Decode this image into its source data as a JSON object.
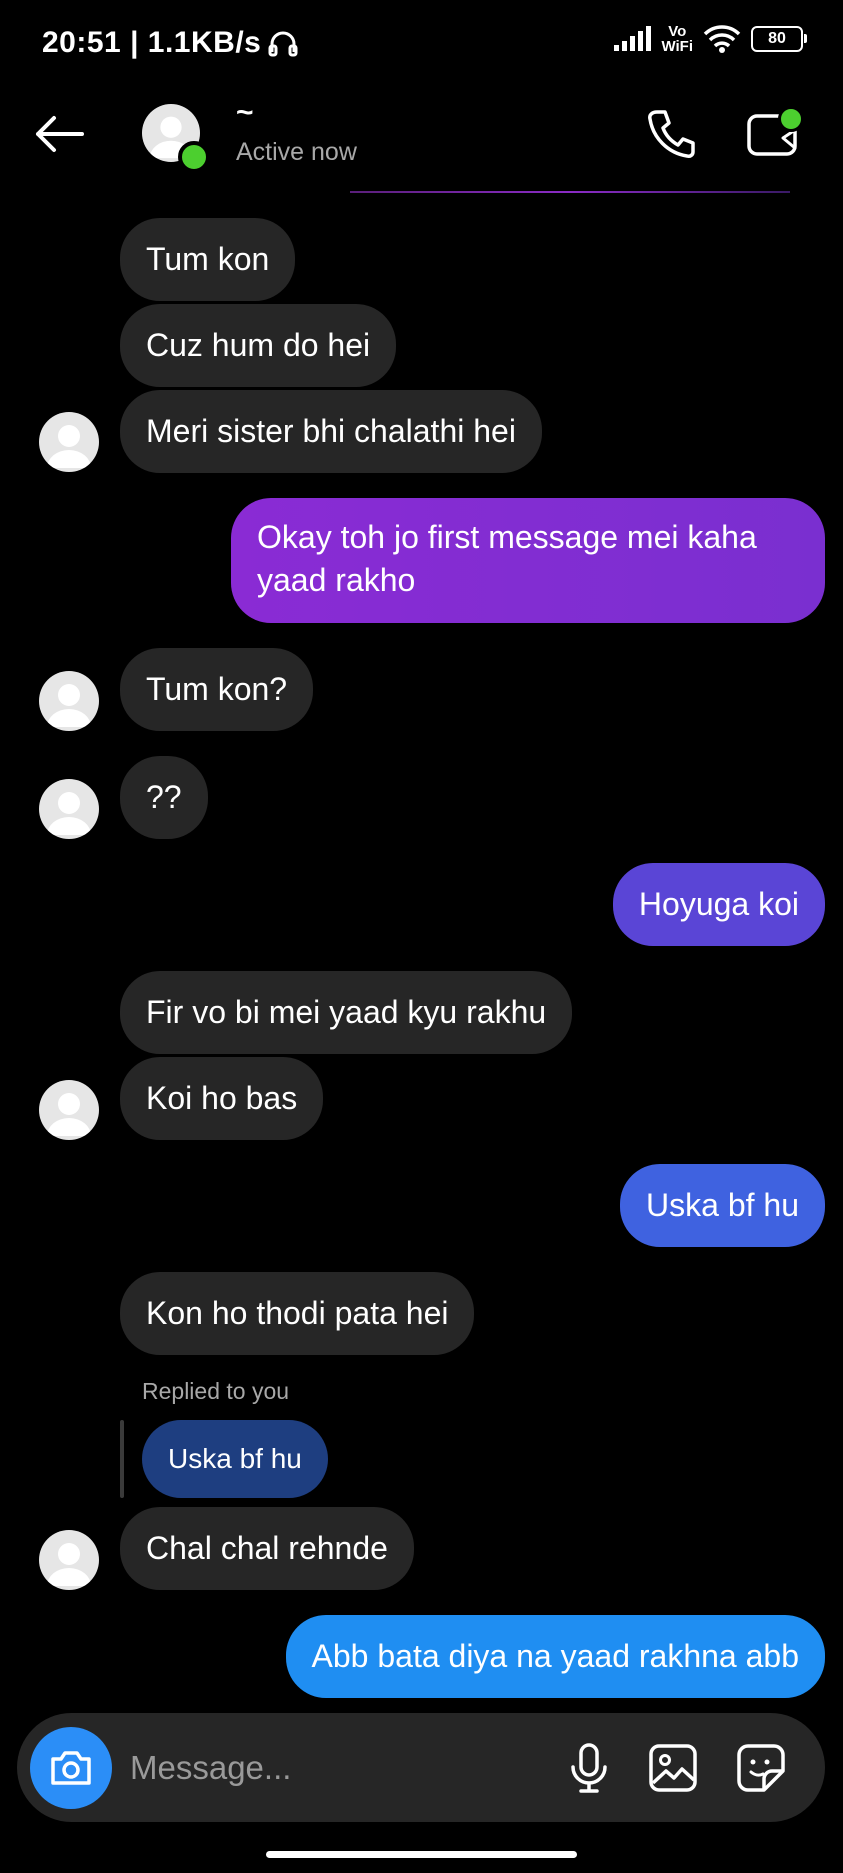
{
  "status_bar": {
    "time_speed": "20:51 | 1.1KB/s",
    "vowifi_top": "Vo",
    "vowifi_bottom": "WiFi",
    "battery": "80"
  },
  "header": {
    "contact_name": "~",
    "contact_status": "Active now",
    "icons": [
      "back-arrow-icon",
      "phone-icon",
      "video-camera-icon"
    ]
  },
  "messages": [
    {
      "side": "in",
      "text": "Tum kon"
    },
    {
      "side": "in",
      "text": "Cuz hum do hei"
    },
    {
      "side": "in",
      "text": "Meri sister bhi chalathi hei"
    },
    {
      "side": "out",
      "text": "Okay toh jo first message mei kaha",
      "text2": "yaad rakho"
    },
    {
      "side": "in",
      "text": "Tum kon?"
    },
    {
      "side": "in",
      "text": "??"
    },
    {
      "side": "out",
      "text": "Hoyuga koi"
    },
    {
      "side": "in",
      "text": "Fir vo bi mei yaad kyu rakhu"
    },
    {
      "side": "in",
      "text": "Koi ho bas"
    },
    {
      "side": "out",
      "text": "Uska bf hu"
    },
    {
      "side": "in",
      "text": "Kon ho thodi pata hei"
    },
    {
      "side": "in",
      "text": "Chal chal rehnde"
    },
    {
      "side": "out",
      "text": "Abb bata diya na yaad rakhna abb"
    }
  ],
  "reply": {
    "label": "Replied to you",
    "quoted_text": "Uska bf hu"
  },
  "composer": {
    "placeholder": "Message...",
    "icons": [
      "camera-icon",
      "microphone-icon",
      "gallery-icon",
      "sticker-icon"
    ]
  },
  "colors": {
    "background": "#000000",
    "incoming_bubble": "#262626",
    "outgoing_purple": "#8a2bd4",
    "outgoing_indigo": "#5a45d6",
    "outgoing_blue": "#3f62e0",
    "outgoing_sky": "#1f8ef2",
    "online_green": "#4ccf2f",
    "camera_button": "#2b8ef7"
  }
}
